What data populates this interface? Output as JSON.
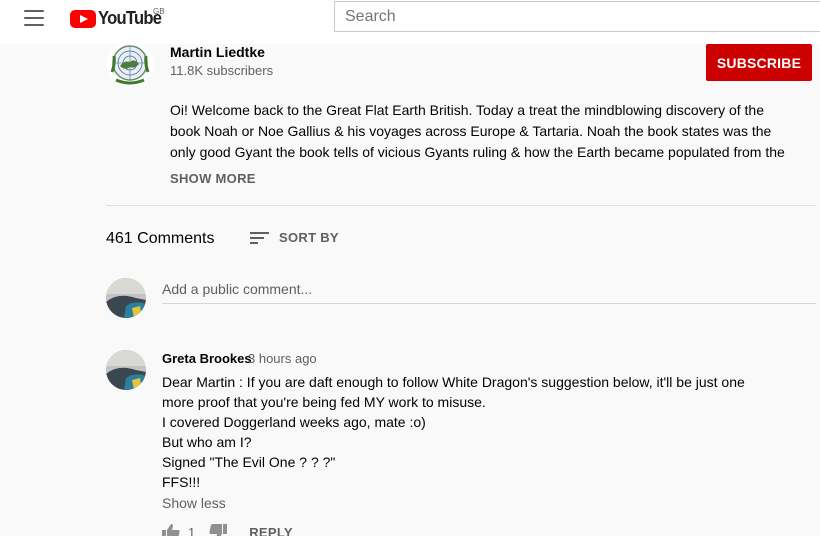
{
  "header": {
    "logo_text": "YouTube",
    "region": "GB",
    "search_placeholder": "Search"
  },
  "channel": {
    "name": "Martin Liedtke",
    "subscribers": "11.8K subscribers",
    "subscribe_label": "SUBSCRIBE"
  },
  "description": {
    "lines": [
      "Oi! Welcome back to the Great Flat Earth British. Today a treat the mindblowing discovery of the",
      "book Noah or Noe Gallius & his voyages across Europe & Tartaria. Noah the book states was the",
      "only good Gyant the book tells of vicious Gyants ruling & how the Earth became populated from the"
    ],
    "show_more": "SHOW MORE"
  },
  "comments": {
    "count_label": "461 Comments",
    "sort_label": "SORT BY",
    "add_placeholder": "Add a public comment...",
    "items": [
      {
        "author": "Greta Brookes",
        "time": "3 hours ago",
        "lines": [
          "Dear Martin : If you are daft enough to follow White Dragon's suggestion below, it'll be just one",
          "more proof that you're being fed MY work to misuse.",
          "I covered Doggerland weeks ago, mate :o)",
          "But who am I?",
          "Signed \"The Evil One ? ? ?\"",
          "FFS!!!"
        ],
        "show_less": "Show less",
        "likes": "1",
        "reply_label": "REPLY"
      }
    ]
  },
  "colors": {
    "brand_red": "#ff0000",
    "subscribe_red": "#cc0000",
    "secondary_text": "#606060"
  }
}
